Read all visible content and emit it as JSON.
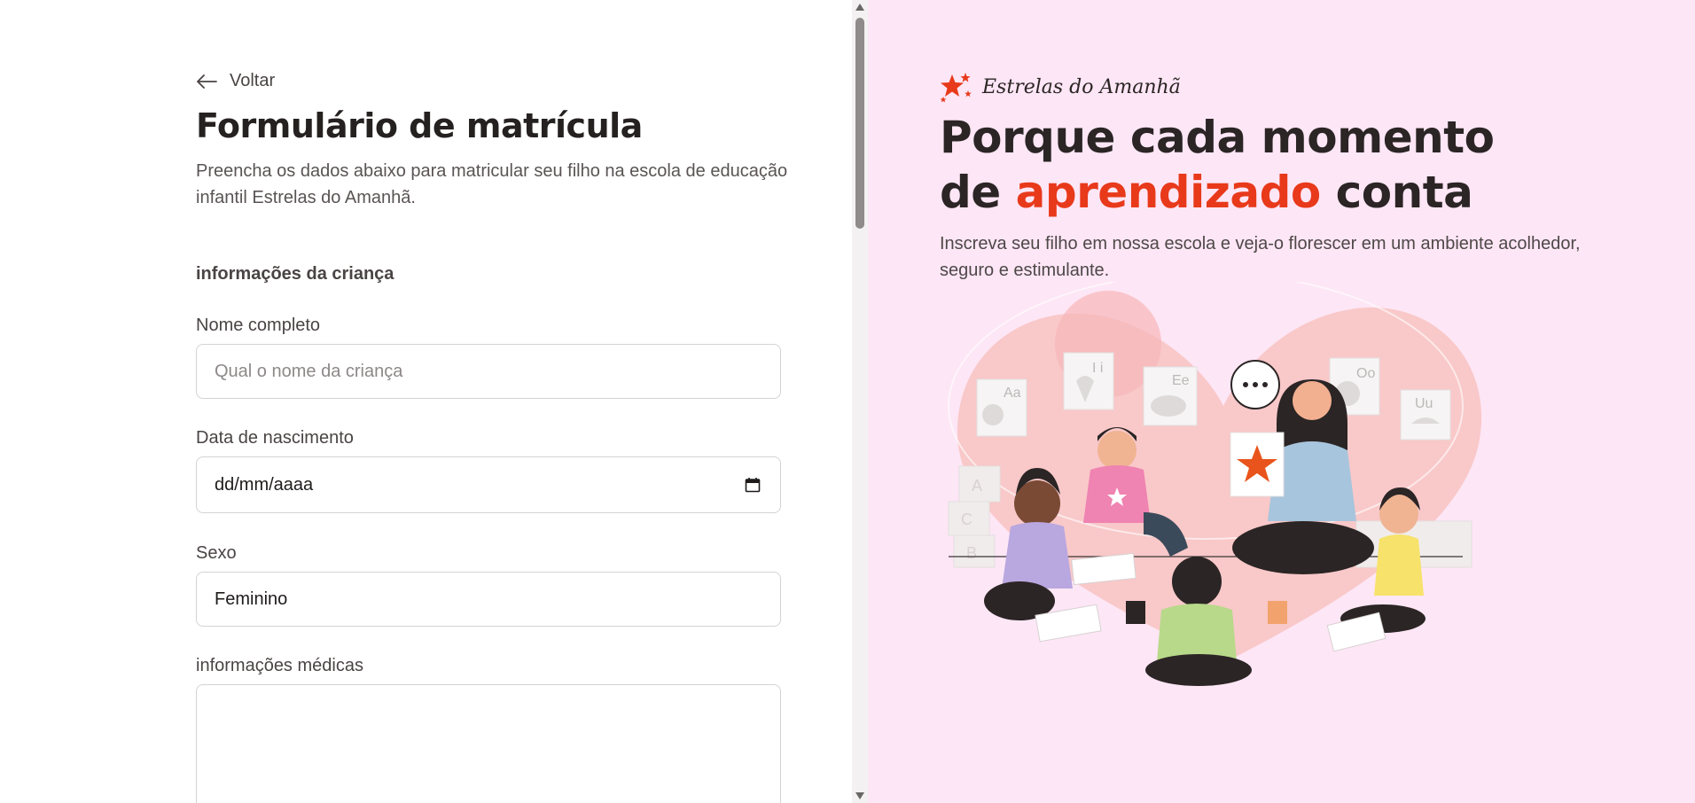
{
  "back": {
    "label": "Voltar"
  },
  "form": {
    "title": "Formulário de matrícula",
    "description": "Preencha os dados abaixo para matricular seu filho na escola de educação infantil Estrelas do Amanhã.",
    "section_heading": "informações da criança",
    "fields": {
      "name": {
        "label": "Nome completo",
        "placeholder": "Qual o nome da criança",
        "value": ""
      },
      "birthdate": {
        "label": "Data de nascimento",
        "value": "dd/mm/aaaa"
      },
      "sex": {
        "label": "Sexo",
        "value": "Feminino"
      },
      "medical": {
        "label": "informações médicas",
        "value": ""
      }
    }
  },
  "hero": {
    "brand_name": "Estrelas do Amanhã",
    "title_line1": "Porque cada momento",
    "title_line2_pre": "de ",
    "title_line2_accent": "aprendizado",
    "title_line2_post": " conta",
    "subtitle": "Inscreva seu filho em nossa escola e veja-o florescer em um ambiente acolhedor, seguro e estimulante.",
    "illustration_icon": "children-learning-illustration"
  },
  "colors": {
    "accent": "#e8391b",
    "right_background": "#fde6f5",
    "heart": "#f9c8c9",
    "text_dark": "#2b2525"
  },
  "icons": {
    "back": "arrow-left-icon",
    "calendar": "calendar-icon",
    "brand": "star-logo-icon",
    "speech": "speech-bubble-icon"
  },
  "illustration_cards": [
    "Aa",
    "I i",
    "Ee",
    "Oo",
    "Uu",
    "A",
    "C",
    "B"
  ]
}
